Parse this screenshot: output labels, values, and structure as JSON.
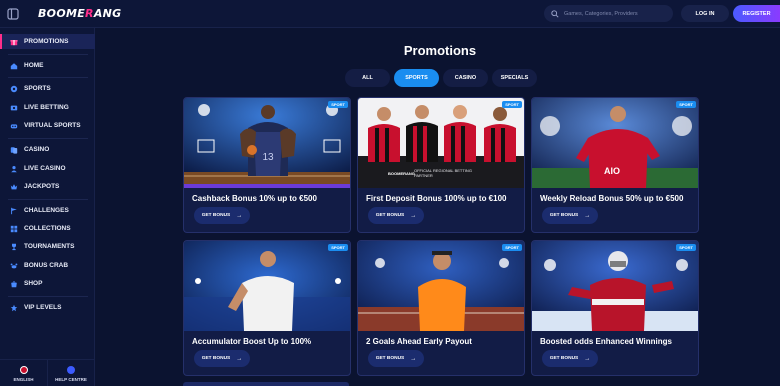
{
  "header": {
    "logo_text_a": "BOOME",
    "logo_text_x": "R",
    "logo_text_b": "ANG",
    "search_placeholder": "Games, Categories, Providers",
    "login_label": "LOG IN",
    "register_label": "REGISTER"
  },
  "sidebar": {
    "items": [
      {
        "label": "PROMOTIONS",
        "icon": "gift-icon"
      },
      {
        "label": "HOME",
        "icon": "home-icon"
      },
      {
        "label": "SPORTS",
        "icon": "ball-icon"
      },
      {
        "label": "LIVE BETTING",
        "icon": "live-icon"
      },
      {
        "label": "VIRTUAL SPORTS",
        "icon": "virtual-icon"
      },
      {
        "label": "CASINO",
        "icon": "cards-icon"
      },
      {
        "label": "LIVE CASINO",
        "icon": "dealer-icon"
      },
      {
        "label": "JACKPOTS",
        "icon": "jackpot-icon"
      },
      {
        "label": "CHALLENGES",
        "icon": "challenge-icon"
      },
      {
        "label": "COLLECTIONS",
        "icon": "collection-icon"
      },
      {
        "label": "TOURNAMENTS",
        "icon": "trophy-icon"
      },
      {
        "label": "BONUS CRAB",
        "icon": "crab-icon"
      },
      {
        "label": "SHOP",
        "icon": "shop-icon"
      },
      {
        "label": "VIP LEVELS",
        "icon": "vip-icon"
      }
    ],
    "language_label": "ENGLISH",
    "help_label": "HELP CENTRE"
  },
  "main": {
    "title": "Promotions",
    "tabs": [
      {
        "label": "ALL",
        "active": false
      },
      {
        "label": "SPORTS",
        "active": true
      },
      {
        "label": "CASINO",
        "active": false
      },
      {
        "label": "SPECIALS",
        "active": false
      }
    ],
    "cards": [
      {
        "badge": "SPORT",
        "title": "Cashback Bonus 10% up to €500",
        "button": "GET BONUS",
        "scene": "basketball"
      },
      {
        "badge": "SPORT",
        "title": "First Deposit Bonus 100% up to €100",
        "button": "GET BONUS",
        "scene": "football-team"
      },
      {
        "badge": "SPORT",
        "title": "Weekly Reload Bonus 50% up to €500",
        "button": "GET BONUS",
        "scene": "football-player"
      },
      {
        "badge": "SPORT",
        "title": "Accumulator Boost Up to 100%",
        "button": "GET BONUS",
        "scene": "tennis"
      },
      {
        "badge": "SPORT",
        "title": "2 Goals Ahead Early Payout",
        "button": "GET BONUS",
        "scene": "padel"
      },
      {
        "badge": "SPORT",
        "title": "Boosted odds Enhanced Winnings",
        "button": "GET BONUS",
        "scene": "hockey"
      }
    ],
    "card2_sign": "OFFICIAL REGIONAL BETTING PARTNER",
    "card2_sponsor": "BOOMERANG",
    "card3_shirt": "AIO"
  },
  "colors": {
    "background": "#0b1330",
    "accent_blue": "#1a8df0",
    "accent_pink": "#ff2e8a",
    "register_gradient": [
      "#4b5bff",
      "#8a3bff"
    ]
  }
}
